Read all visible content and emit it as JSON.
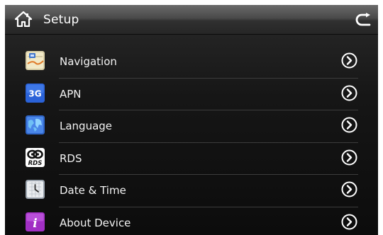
{
  "header": {
    "title": "Setup",
    "icons": {
      "home": "home-icon",
      "back": "return-arrow-icon"
    }
  },
  "menu": {
    "items": [
      {
        "label": "Navigation",
        "icon": "navigation-map-icon"
      },
      {
        "label": "APN",
        "icon": "3g-network-icon",
        "icon_text": "3G"
      },
      {
        "label": "Language",
        "icon": "language-globe-icon"
      },
      {
        "label": "RDS",
        "icon": "rds-radio-icon",
        "icon_text": "RDS"
      },
      {
        "label": "Date & Time",
        "icon": "date-time-clock-icon"
      },
      {
        "label": "About Device",
        "icon": "info-icon",
        "icon_text": "i"
      }
    ],
    "chevron_icon": "chevron-right-circle-icon"
  },
  "colors": {
    "header_top": "#6a6a6a",
    "background": "#161616",
    "text": "#f2f2f2",
    "divider": "#3c3c3c"
  }
}
